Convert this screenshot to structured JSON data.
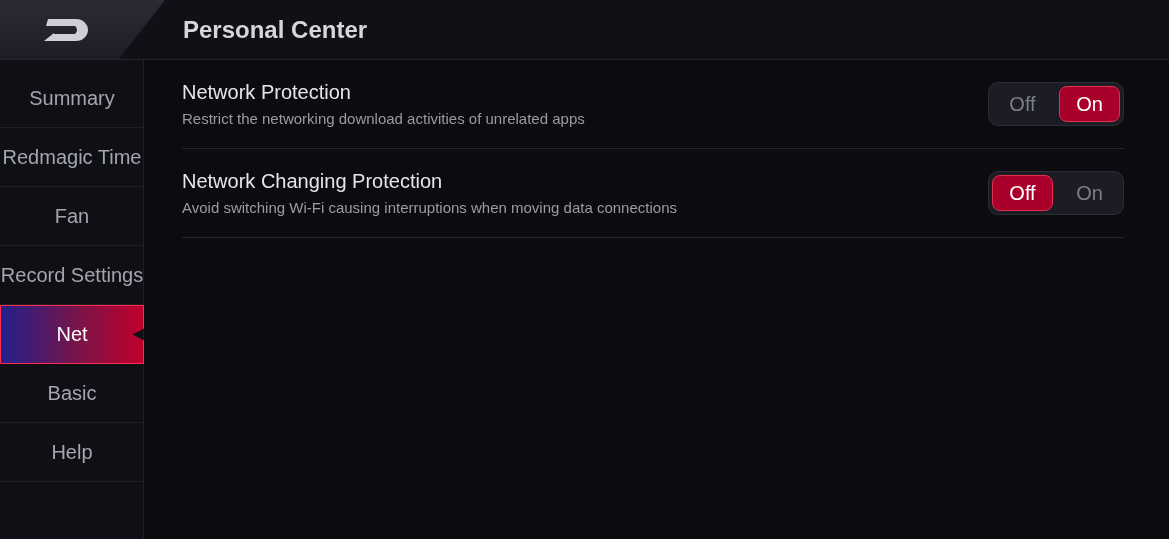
{
  "header": {
    "title": "Personal Center"
  },
  "sidebar": {
    "items": [
      {
        "label": "Summary",
        "selected": false
      },
      {
        "label": "Redmagic Time",
        "selected": false
      },
      {
        "label": "Fan",
        "selected": false
      },
      {
        "label": "Record Settings",
        "selected": false
      },
      {
        "label": "Net",
        "selected": true
      },
      {
        "label": "Basic",
        "selected": false
      },
      {
        "label": "Help",
        "selected": false
      }
    ]
  },
  "settings": [
    {
      "title": "Network Protection",
      "description": "Restrict the networking download activities of unrelated apps",
      "options": [
        {
          "label": "Off",
          "selected": false
        },
        {
          "label": "On",
          "selected": true
        }
      ]
    },
    {
      "title": "Network Changing Protection",
      "description": "Avoid switching Wi-Fi causing interruptions when moving data connections",
      "options": [
        {
          "label": "Off",
          "selected": true
        },
        {
          "label": "On",
          "selected": false
        }
      ]
    }
  ]
}
